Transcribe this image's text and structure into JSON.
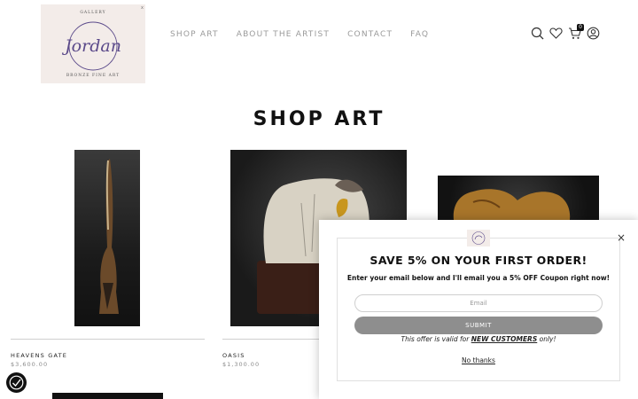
{
  "brand": {
    "top_text": "GALLERY",
    "name": "Jordan",
    "bottom_text": "BRONZE FINE ART",
    "close_mark": "x"
  },
  "nav": {
    "items": [
      {
        "label": "SHOP ART"
      },
      {
        "label": "ABOUT THE ARTIST"
      },
      {
        "label": "CONTACT"
      },
      {
        "label": "FAQ"
      }
    ]
  },
  "header_icons": {
    "search": "search-icon",
    "wishlist": "heart-icon",
    "cart": "cart-icon",
    "cart_count": "0",
    "account": "user-icon"
  },
  "page": {
    "title": "SHOP ART"
  },
  "products": [
    {
      "name": "HEAVENS GATE",
      "price": "$3,600.00"
    },
    {
      "name": "OASIS",
      "price": "$1,300.00"
    }
  ],
  "popup": {
    "close_symbol": "×",
    "heading": "SAVE 5% ON YOUR FIRST ORDER!",
    "subheading": "Enter your email below and I'll email you a 5% OFF Coupon right now!",
    "email_placeholder": "Email",
    "submit_label": "SUBMIT",
    "offer_prefix": "This offer is valid for ",
    "offer_highlight": "NEW CUSTOMERS",
    "offer_suffix": " only!",
    "dismiss_label": "No thanks"
  },
  "colors": {
    "accent": "#5b4a8a",
    "logo_bg": "#f3ece9",
    "submit_bg": "#8e8e8e"
  }
}
